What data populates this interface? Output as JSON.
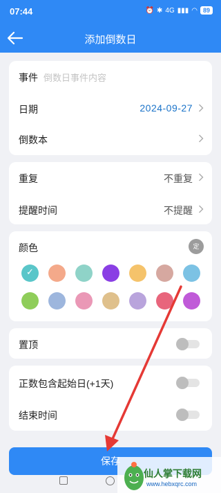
{
  "status": {
    "time": "07:44",
    "battery": "89",
    "network": "4G"
  },
  "header": {
    "title": "添加倒数日"
  },
  "form": {
    "event_label": "事件",
    "event_placeholder": "倒数日事件内容",
    "date_label": "日期",
    "date_value": "2024-09-27",
    "book_label": "倒数本",
    "repeat_label": "重复",
    "repeat_value": "不重复",
    "reminder_label": "提醒时间",
    "reminder_value": "不提醒",
    "color_label": "颜色",
    "color_custom": "定",
    "pin_label": "置顶",
    "include_start_label": "正数包含起始日(+1天)",
    "end_time_label": "结束时间",
    "save_label": "保存"
  },
  "colors": {
    "row1": [
      "#5ac6c9",
      "#f4a98a",
      "#8fd3c8",
      "#8a3fe4",
      "#f5c36b",
      "#d6a8a0",
      "#7cc2e4"
    ],
    "row2": [
      "#8fcd5a",
      "#9db6dd",
      "#ea98b6",
      "#dfc08c",
      "#b9a4dc",
      "#e8657c",
      "#c05ad8"
    ],
    "selected_index": 0,
    "accent": "#2f89f5"
  },
  "watermark": {
    "text": "仙人掌下载网",
    "url": "www.hebxqrc.com"
  }
}
